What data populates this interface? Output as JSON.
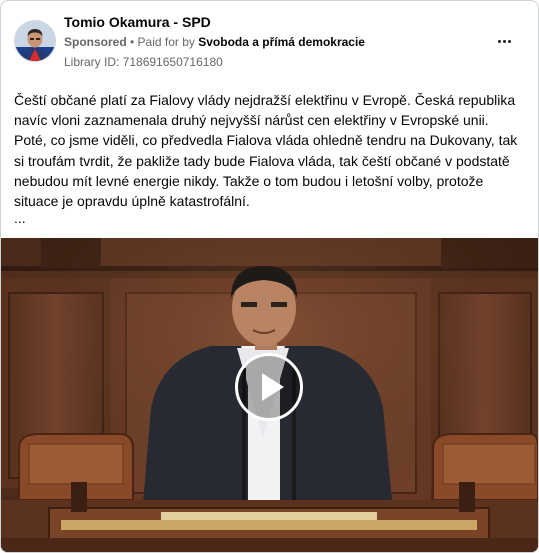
{
  "post": {
    "page_name": "Tomio Okamura - SPD",
    "sponsored_label": "Sponsored",
    "separator": " • ",
    "paid_for_label": "Paid for by ",
    "payer": "Svoboda a přímá demokracie",
    "library_id": "Library ID: 718691650716180",
    "text": "Čeští občané platí za Fialovy vlády nejdražší elektřinu v Evropě. Česká republika navíc vloni zaznamenala druhý nejvyšší nárůst cen elektřiny v Evropské unii. Poté, co jsme viděli, co předvedla Fialova vláda ohledně tendru na Dukovany, tak si troufám tvrdit, že pakliže tady bude Fialova vláda, tak čeští občané v podstatě nebudou mít levné energie nikdy. Takže o tom budou i letošní volby, protože situace je opravdu úplně katastrofální.",
    "truncation": "..."
  },
  "icons": {
    "avatar": "avatar-photo",
    "more": "more-options-icon",
    "play": "play-icon"
  },
  "colors": {
    "border": "#cfd2d6",
    "secondary_text": "#65676b",
    "primary_text": "#050505",
    "video_wood": "#6b3f28"
  }
}
